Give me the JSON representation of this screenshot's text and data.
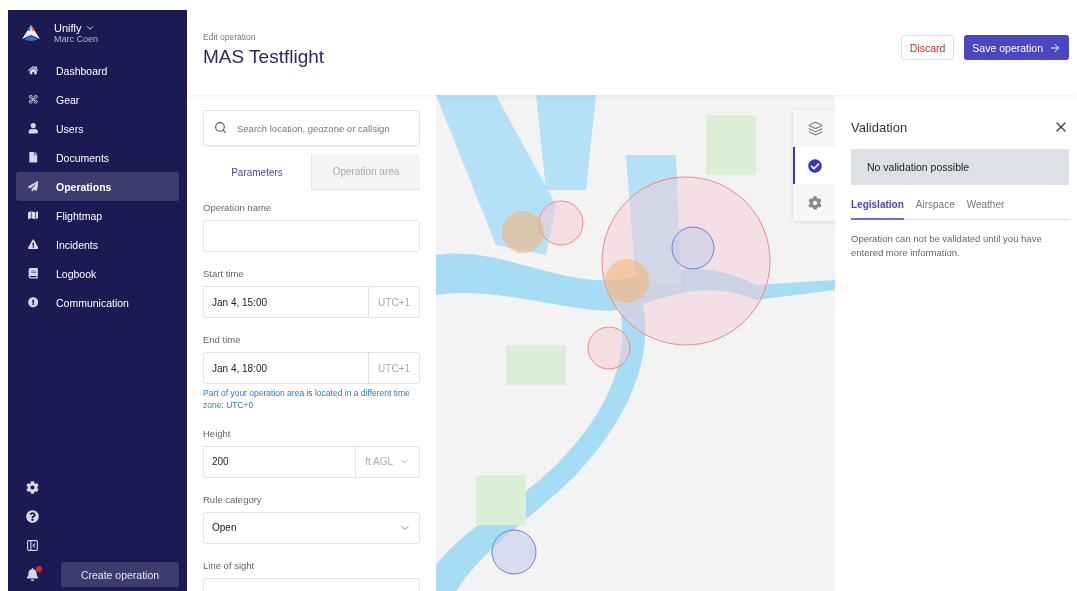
{
  "account": {
    "org": "Unifly",
    "user": "Marc Coen"
  },
  "nav": [
    {
      "kind": "home",
      "label": "Dashboard",
      "selected": false
    },
    {
      "kind": "drone",
      "label": "Gear",
      "selected": false
    },
    {
      "kind": "user",
      "label": "Users",
      "selected": false
    },
    {
      "kind": "document",
      "label": "Documents",
      "selected": false
    },
    {
      "kind": "plane",
      "label": "Operations",
      "selected": true
    },
    {
      "kind": "map",
      "label": "Flightmap",
      "selected": false
    },
    {
      "kind": "warning",
      "label": "Incidents",
      "selected": false
    },
    {
      "kind": "book",
      "label": "Logbook",
      "selected": false
    },
    {
      "kind": "alert",
      "label": "Communication",
      "selected": false
    }
  ],
  "sidebar_tools": [
    {
      "kind": "settings",
      "alert": false
    },
    {
      "kind": "help",
      "alert": false
    },
    {
      "kind": "collapse",
      "alert": false
    },
    {
      "kind": "notifications",
      "alert": true
    }
  ],
  "create_button": "Create operation",
  "header": {
    "breadcrumb": "Edit operation",
    "title": "MAS Testflight",
    "discard": "Discard",
    "save": "Save operation"
  },
  "search": {
    "placeholder": "Search location, geozone or callsign"
  },
  "form_tabs": [
    {
      "label": "Parameters",
      "selected": true
    },
    {
      "label": "Operation area",
      "selected": false
    }
  ],
  "fields": [
    {
      "kind": "text",
      "label": "Operation name"
    },
    {
      "kind": "time",
      "label": "Start time",
      "value": "Jan 4, 15:00",
      "suffix": "UTC+1"
    },
    {
      "kind": "time",
      "label": "End time",
      "value": "Jan 4, 18:00",
      "suffix": "UTC+1",
      "note": "Part of your operation area is located in a different time zone: UTC+0"
    },
    {
      "kind": "unit",
      "label": "Height",
      "value": "200",
      "suffix": "ft AGL"
    },
    {
      "kind": "select",
      "label": "Rule category",
      "value": "Open"
    },
    {
      "kind": "text",
      "label": "Line of sight"
    }
  ],
  "map_controls": [
    {
      "kind": "layers",
      "selected": false
    },
    {
      "kind": "validation",
      "selected": true
    },
    {
      "kind": "settings",
      "selected": false
    }
  ],
  "validation": {
    "title": "Validation",
    "status": "No validation possible",
    "tabs": [
      {
        "label": "Legislation",
        "selected": true
      },
      {
        "label": "Airspace",
        "selected": false
      },
      {
        "label": "Weather",
        "selected": false
      }
    ],
    "message": "Operation can not be validated until you have entered more information."
  }
}
